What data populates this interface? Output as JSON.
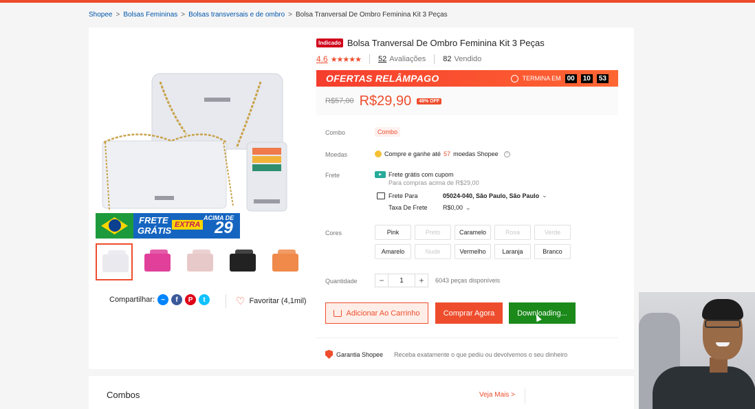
{
  "breadcrumb": {
    "items": [
      "Shopee",
      "Bolsas Femininas",
      "Bolsas transversais e de ombro"
    ],
    "current": "Bolsa Tranversal De Ombro Feminina Kit 3 Peças"
  },
  "product": {
    "badge": "Indicado",
    "title": "Bolsa Tranversal De Ombro Feminina Kit 3 Peças",
    "rating": "4.6",
    "stars": "★★★★★",
    "reviews_count": "52",
    "reviews_label": "Avaliações",
    "sold_count": "82",
    "sold_label": "Vendido"
  },
  "flash": {
    "label": "OFERTAS RELÂMPAGO",
    "ends_label": "TERMINA EM",
    "hh": "00",
    "mm": "10",
    "ss": "53"
  },
  "price": {
    "old": "R$57,00",
    "new": "R$29,90",
    "discount": "48% OFF"
  },
  "labels": {
    "combo": "Combo",
    "moedas": "Moedas",
    "frete": "Frete",
    "cores": "Cores",
    "quantidade": "Quantidade"
  },
  "combo_tag": "Combo",
  "moedas": {
    "pre": "Compre e ganhe até",
    "value": "57",
    "post": "moedas Shopee"
  },
  "frete": {
    "free_label": "Frete grátis com cupom",
    "free_sub": "Para compras acima de R$29,00",
    "para_label": "Frete Para",
    "para_value": "05024-040, São Paulo, São Paulo",
    "taxa_label": "Taxa De Frete",
    "taxa_value": "R$0,00"
  },
  "colors": [
    {
      "name": "Pink",
      "disabled": false
    },
    {
      "name": "Preto",
      "disabled": true
    },
    {
      "name": "Caramelo",
      "disabled": false
    },
    {
      "name": "Rosa",
      "disabled": true
    },
    {
      "name": "Verde",
      "disabled": true
    },
    {
      "name": "Amarelo",
      "disabled": false
    },
    {
      "name": "Nude",
      "disabled": true
    },
    {
      "name": "Vermelho",
      "disabled": false
    },
    {
      "name": "Laranja",
      "disabled": false
    },
    {
      "name": "Branco",
      "disabled": false
    }
  ],
  "quantity": {
    "value": "1",
    "available": "6043 peças disponíveis"
  },
  "buttons": {
    "cart": "Adicionar Ao Carrinho",
    "buy": "Comprar Agora",
    "download": "Downloading..."
  },
  "guarantee": {
    "title": "Garantia Shopee",
    "desc": "Receba exatamente o que pediu ou devolvemos o seu dinheiro"
  },
  "share": {
    "label": "Compartilhar:",
    "favorite": "Favoritar (4,1mil)"
  },
  "banner": {
    "line1": "FRETE",
    "line2": "GRÁTIS",
    "extra": "EXTRA",
    "acima": "ACIMA DE",
    "currency": "R$",
    "amount": "29"
  },
  "combos": {
    "title": "Combos",
    "see_more": "Veja Mais"
  },
  "colors_theme": {
    "accent": "#ee4d2d",
    "download_btn": "#1b8a1b"
  },
  "thumbnails": [
    "#e9e9ee",
    "#e0409a",
    "#e8c9c9",
    "#222222",
    "#ef8a4a"
  ]
}
